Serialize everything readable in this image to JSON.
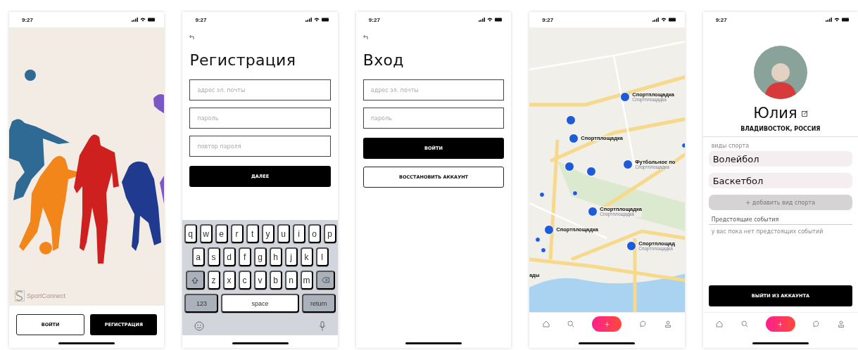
{
  "screens": [
    {
      "kind": "welcome",
      "status_bar": {
        "time": "9:27"
      },
      "logo": "SportConnect",
      "buttons": [
        {
          "label": "ВОЙТИ",
          "kind": "outline"
        },
        {
          "label": "РЕГИСТРАЦИЯ",
          "kind": "filled"
        }
      ]
    },
    {
      "kind": "form",
      "status_bar": {
        "time": "9:27"
      },
      "title": "Регистрация",
      "fields": [
        {
          "placeholder": "адрес эл. почты"
        },
        {
          "placeholder": "пароль"
        },
        {
          "placeholder": "повтор пароля"
        }
      ],
      "buttons": [
        {
          "label": "ДАЛЕЕ",
          "kind": "filled"
        }
      ],
      "keyboard": {
        "rows": [
          {
            "keys": [
              {
                "kind": "letter",
                "label": "q"
              },
              {
                "kind": "letter",
                "label": "w"
              },
              {
                "kind": "letter",
                "label": "e"
              },
              {
                "kind": "letter",
                "label": "r"
              },
              {
                "kind": "letter",
                "label": "t"
              },
              {
                "kind": "letter",
                "label": "y"
              },
              {
                "kind": "letter",
                "label": "u"
              },
              {
                "kind": "letter",
                "label": "i"
              },
              {
                "kind": "letter",
                "label": "o"
              },
              {
                "kind": "letter",
                "label": "p"
              }
            ]
          },
          {
            "keys": [
              {
                "kind": "letter",
                "label": "a"
              },
              {
                "kind": "letter",
                "label": "s"
              },
              {
                "kind": "letter",
                "label": "d"
              },
              {
                "kind": "letter",
                "label": "f"
              },
              {
                "kind": "letter",
                "label": "g"
              },
              {
                "kind": "letter",
                "label": "h"
              },
              {
                "kind": "letter",
                "label": "j"
              },
              {
                "kind": "letter",
                "label": "k"
              },
              {
                "kind": "letter",
                "label": "l"
              }
            ]
          },
          {
            "keys": [
              {
                "kind": "shift"
              },
              {
                "kind": "letter",
                "label": "z"
              },
              {
                "kind": "letter",
                "label": "x"
              },
              {
                "kind": "letter",
                "label": "c"
              },
              {
                "kind": "letter",
                "label": "v"
              },
              {
                "kind": "letter",
                "label": "b"
              },
              {
                "kind": "letter",
                "label": "n"
              },
              {
                "kind": "letter",
                "label": "m"
              },
              {
                "kind": "backspace"
              }
            ]
          },
          {
            "keys": [
              {
                "kind": "mode",
                "label": "123"
              },
              {
                "kind": "space",
                "label": "space"
              },
              {
                "kind": "return",
                "label": "return"
              }
            ]
          },
          {
            "keys": [
              {
                "kind": "emoji"
              },
              {
                "kind": "mic"
              }
            ]
          }
        ]
      }
    },
    {
      "kind": "form",
      "status_bar": {
        "time": "9:27"
      },
      "title": "Вход",
      "fields": [
        {
          "placeholder": "адрес эл. почты"
        },
        {
          "placeholder": "пароль"
        }
      ],
      "buttons": [
        {
          "label": "ВОЙТИ",
          "kind": "filled"
        },
        {
          "label": "ВОССТАНОВИТЬ АККАУНТ",
          "kind": "outline"
        }
      ]
    },
    {
      "kind": "map",
      "status_bar": {
        "time": "9:27"
      },
      "pins": [
        {
          "title": "Спортплощадка",
          "subtitle": "Спортплощадка"
        },
        {
          "title": "Спортплощадка"
        },
        {
          "title": "Футбольное по",
          "subtitle": "Спортплощадка"
        },
        {
          "title": "Спортплощадка",
          "subtitle": "Спортплощадка"
        },
        {
          "title": "Спортплощадка"
        },
        {
          "title": "Спортплощад",
          "subtitle": "Спортплощадка"
        }
      ],
      "map_labels": [
        "ады"
      ]
    },
    {
      "kind": "profile",
      "status_bar": {
        "time": "9:27"
      },
      "name": "Юлия",
      "city": "ВЛАДИВОСТОК, РОССИЯ",
      "sports_label": "виды спорта",
      "sports": [
        "Волейбол",
        "Баскетбол"
      ],
      "add_sport": "+ добавить вид спорта",
      "events_title": "Предстоящие события",
      "events_empty": "у вас пока нет предстоящих событий",
      "buttons": [
        {
          "label": "ВЫЙТИ ИЗ АККАУНТА",
          "kind": "filled"
        }
      ]
    }
  ]
}
